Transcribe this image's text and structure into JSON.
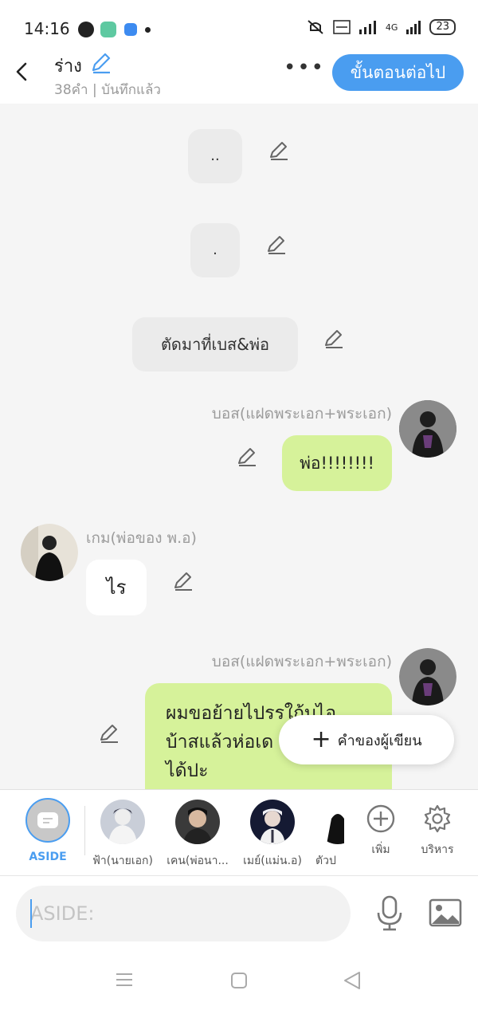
{
  "status": {
    "time": "14:16",
    "battery": "23",
    "net_label": "4G"
  },
  "header": {
    "title": "ร่าง",
    "subtitle": "38คำ | บันทึกแล้ว",
    "more": "•••",
    "next_label": "ขั้นตอนต่อไป"
  },
  "messages": [
    {
      "type": "narration",
      "text": ".."
    },
    {
      "type": "narration",
      "text": "."
    },
    {
      "type": "narration",
      "text": "ตัดมาที่เบส&พ่อ"
    },
    {
      "type": "right",
      "sender": "บอส(แฝดพระเอก+พระเอก)",
      "text": "พ่อ!!!!!!!!"
    },
    {
      "type": "left",
      "sender": "เกม(พ่อของ พ.อ)",
      "text": "ไร"
    },
    {
      "type": "right",
      "sender": "บอส(แฝดพระเอก+พระเอก)",
      "lines": [
        "ผมขอย้ายไปรรใก้บไอ",
        "บ้าสแล้วห่อเด",
        "ได้ปะ"
      ]
    }
  ],
  "author_button": {
    "plus": "+",
    "label": "คำของผู้เขียน"
  },
  "characters": {
    "aside_label": "ASIDE",
    "list": [
      {
        "name": "ฟ้า(นายเอก)"
      },
      {
        "name": "เคน(พ่อนา..."
      },
      {
        "name": "เมย์(แม่น.อ)"
      },
      {
        "name": "ตัวป"
      }
    ],
    "add_label": "เพิ่ม",
    "manage_label": "บริหาร"
  },
  "input": {
    "placeholder": "ASIDE:"
  },
  "colors": {
    "accent": "#4a9df0",
    "green_bubble": "#d6f29a",
    "gray_bubble": "#ebebeb"
  }
}
